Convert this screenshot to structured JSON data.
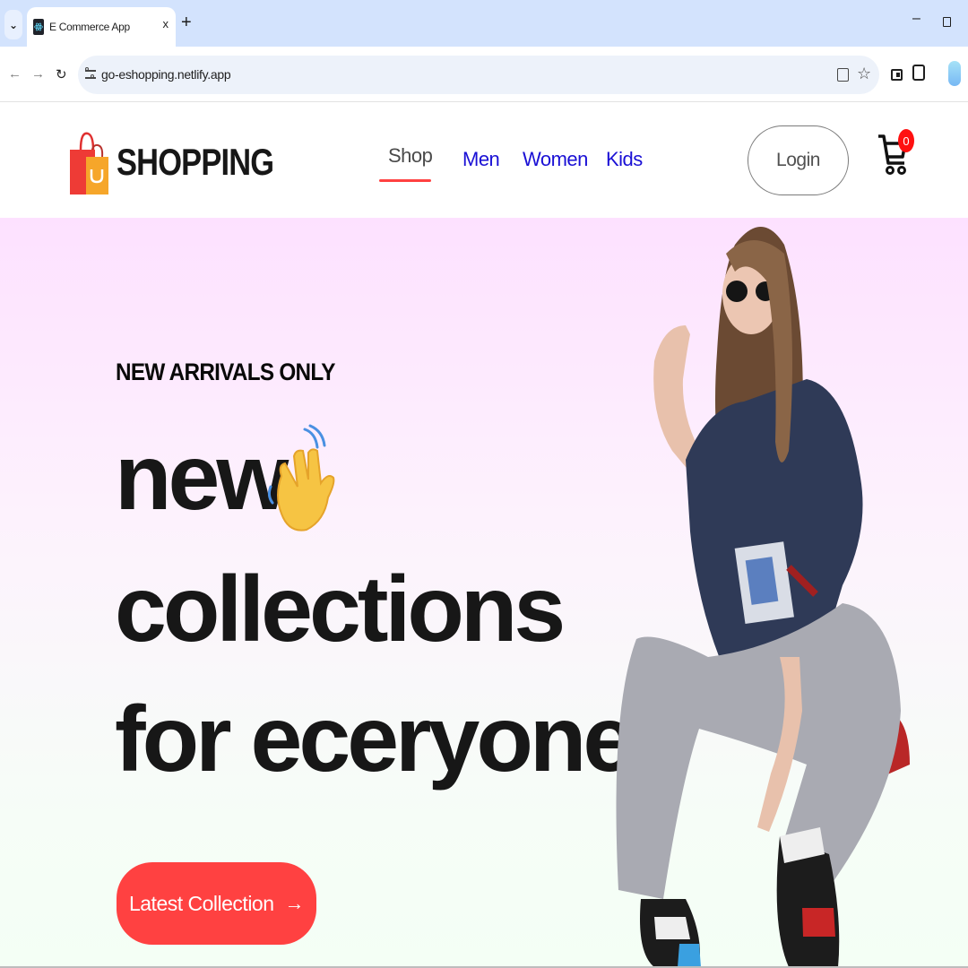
{
  "browser": {
    "tab_title": "E Commerce App",
    "tab_close": "x",
    "new_tab": "+",
    "url": "go-eshopping.netlify.app",
    "minimize": "–"
  },
  "site": {
    "brand": "SHOPPING",
    "nav": [
      {
        "label": "Shop",
        "active": true
      },
      {
        "label": "Men",
        "active": false
      },
      {
        "label": "Women",
        "active": false
      },
      {
        "label": "Kids",
        "active": false
      }
    ],
    "login_label": "Login",
    "cart_count": "0"
  },
  "hero": {
    "kicker": "NEW ARRIVALS ONLY",
    "line1": "new",
    "line2": "collections",
    "line3": "for eceryone",
    "cta_label": "Latest Collection",
    "cta_arrow": "→"
  },
  "colors": {
    "accent": "#ff4141",
    "nav_link": "#1a10d5",
    "hero_top": "#fde1ff",
    "hero_bottom": "#f4fff5"
  },
  "icons": [
    "tab-menu-icon",
    "react-favicon-icon",
    "back-icon",
    "forward-icon",
    "reload-icon",
    "site-settings-icon",
    "install-icon",
    "bookmark-star-icon",
    "side-panel-icon",
    "extensions-icon",
    "shopping-bag-logo-icon",
    "cart-icon",
    "waving-hand-icon",
    "arrow-right-icon"
  ]
}
